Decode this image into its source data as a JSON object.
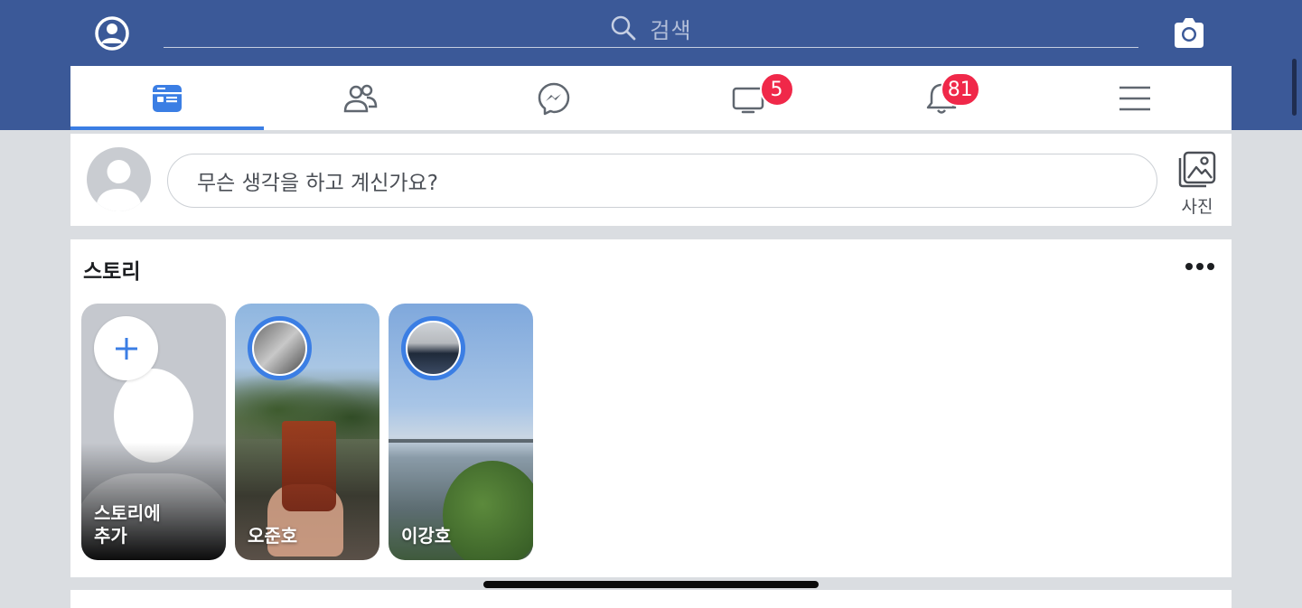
{
  "topbar": {
    "search_placeholder": "검색",
    "background_color": "#3b5998"
  },
  "tabs": [
    {
      "name": "news-feed",
      "icon": "news-feed-icon",
      "active": true
    },
    {
      "name": "friends",
      "icon": "friends-icon",
      "active": false
    },
    {
      "name": "messenger",
      "icon": "messenger-icon",
      "active": false
    },
    {
      "name": "watch",
      "icon": "watch-icon",
      "badge": "5",
      "active": false
    },
    {
      "name": "notifications",
      "icon": "bell-icon",
      "badge": "81",
      "active": false
    },
    {
      "name": "menu",
      "icon": "menu-icon",
      "active": false
    }
  ],
  "composer": {
    "placeholder": "무슨 생각을 하고 계신가요?",
    "photo_label": "사진"
  },
  "stories": {
    "title": "스토리",
    "add_story_label": "스토리에\n추가",
    "items": [
      {
        "name": "오준호"
      },
      {
        "name": "이강호"
      }
    ]
  },
  "colors": {
    "accent": "#3b7ee4",
    "badge": "#f02849"
  }
}
